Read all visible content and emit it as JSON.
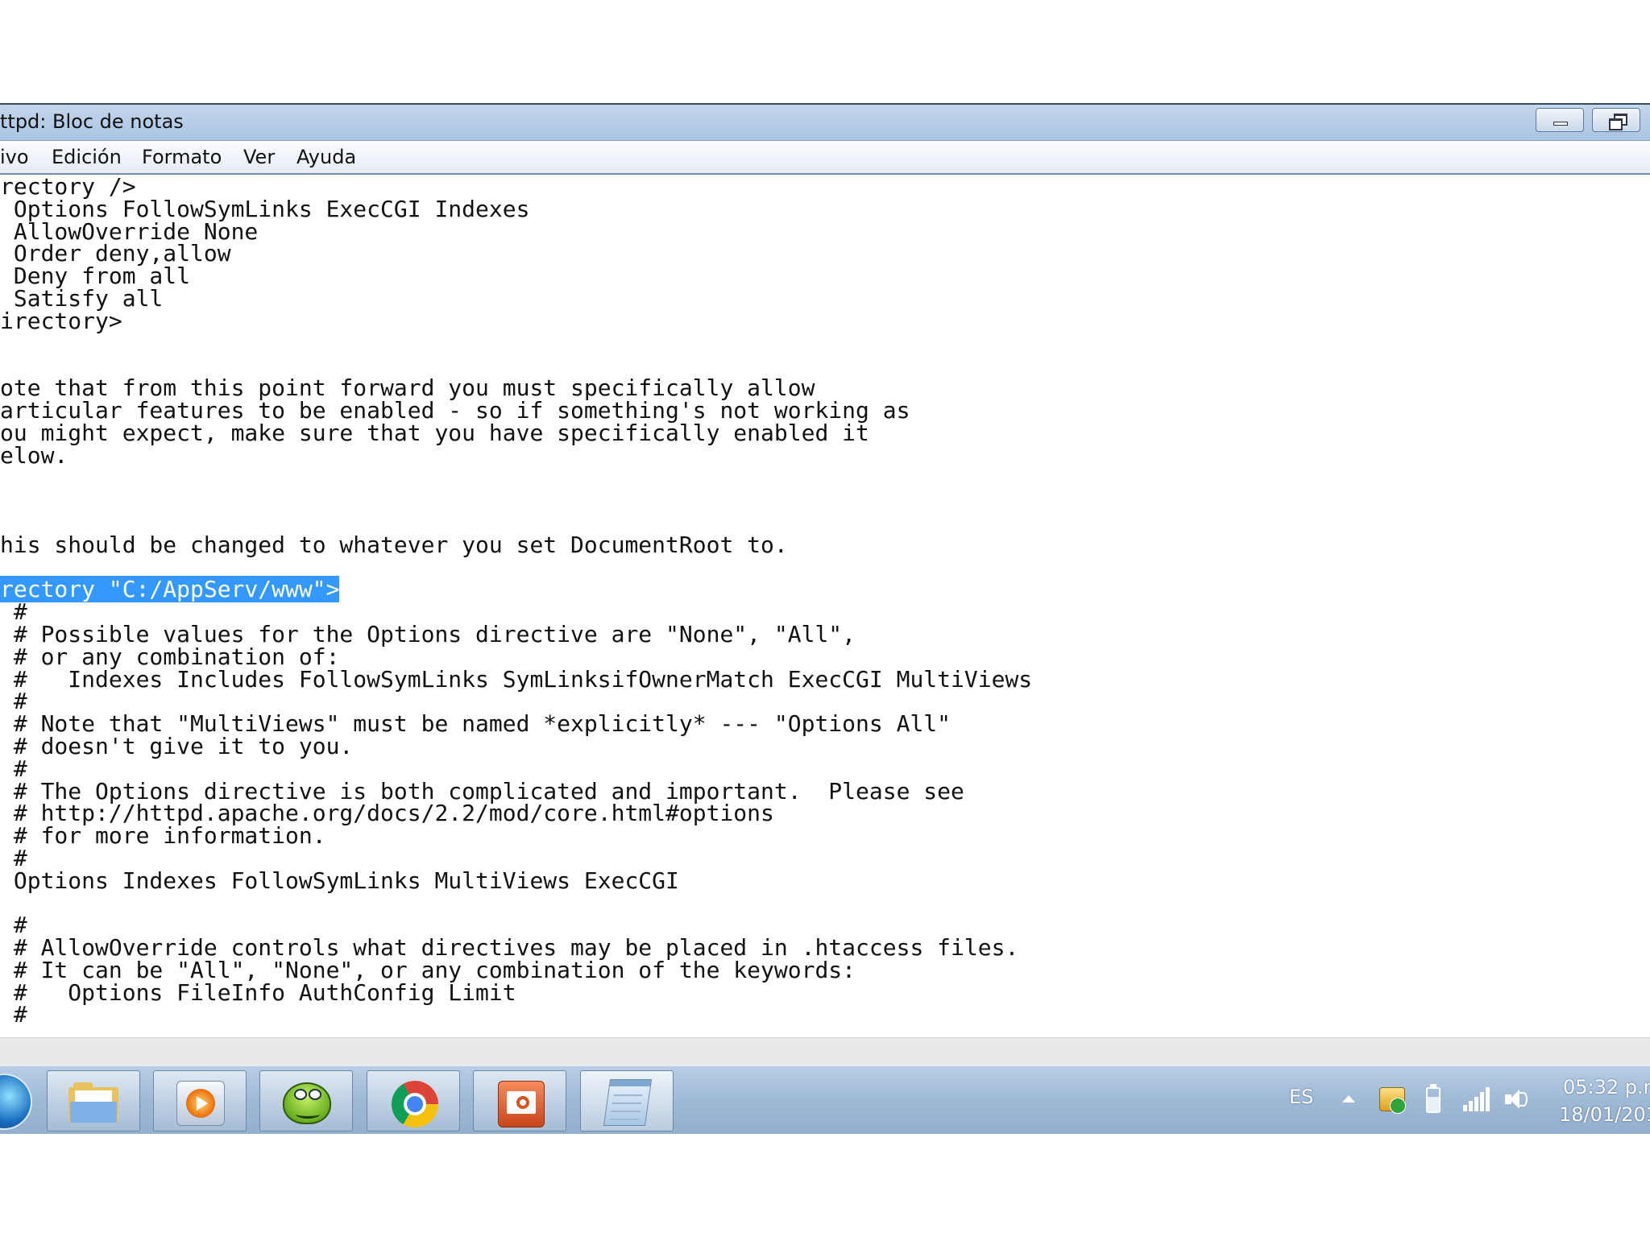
{
  "window": {
    "title": "ttpd: Bloc de notas"
  },
  "menu": {
    "archivo": "ivo",
    "edicion": "Edición",
    "formato": "Formato",
    "ver": "Ver",
    "ayuda": "Ayuda"
  },
  "editor": {
    "lines": [
      "rectory />",
      " Options FollowSymLinks ExecCGI Indexes",
      " AllowOverride None",
      " Order deny,allow",
      " Deny from all",
      " Satisfy all",
      "irectory>",
      "",
      "",
      "ote that from this point forward you must specifically allow",
      "articular features to be enabled - so if something's not working as",
      "ou might expect, make sure that you have specifically enabled it",
      "elow.",
      "",
      "",
      "",
      "his should be changed to whatever you set DocumentRoot to.",
      "",
      "rectory \"C:/AppServ/www\">",
      " #",
      " # Possible values for the Options directive are \"None\", \"All\",",
      " # or any combination of:",
      " #   Indexes Includes FollowSymLinks SymLinksifOwnerMatch ExecCGI MultiViews",
      " #",
      " # Note that \"MultiViews\" must be named *explicitly* --- \"Options All\"",
      " # doesn't give it to you.",
      " #",
      " # The Options directive is both complicated and important.  Please see",
      " # http://httpd.apache.org/docs/2.2/mod/core.html#options",
      " # for more information.",
      " #",
      " Options Indexes FollowSymLinks MultiViews ExecCGI",
      "",
      " #",
      " # AllowOverride controls what directives may be placed in .htaccess files.",
      " # It can be \"All\", \"None\", or any combination of the keywords:",
      " #   Options FileInfo AuthConfig Limit",
      " #"
    ],
    "selected_line": 18,
    "selection_color": "#3399ff"
  },
  "taskbar": {
    "buttons": [
      {
        "name": "explorer",
        "icon": "folder-icon"
      },
      {
        "name": "media-player",
        "icon": "media-player-icon"
      },
      {
        "name": "frog-app",
        "icon": "frog-icon"
      },
      {
        "name": "chrome",
        "icon": "chrome-icon"
      },
      {
        "name": "powerpoint",
        "icon": "powerpoint-icon"
      },
      {
        "name": "notepad",
        "icon": "notepad-icon"
      }
    ],
    "language": "ES",
    "time": "05:32 p.m",
    "date": "18/01/201"
  }
}
